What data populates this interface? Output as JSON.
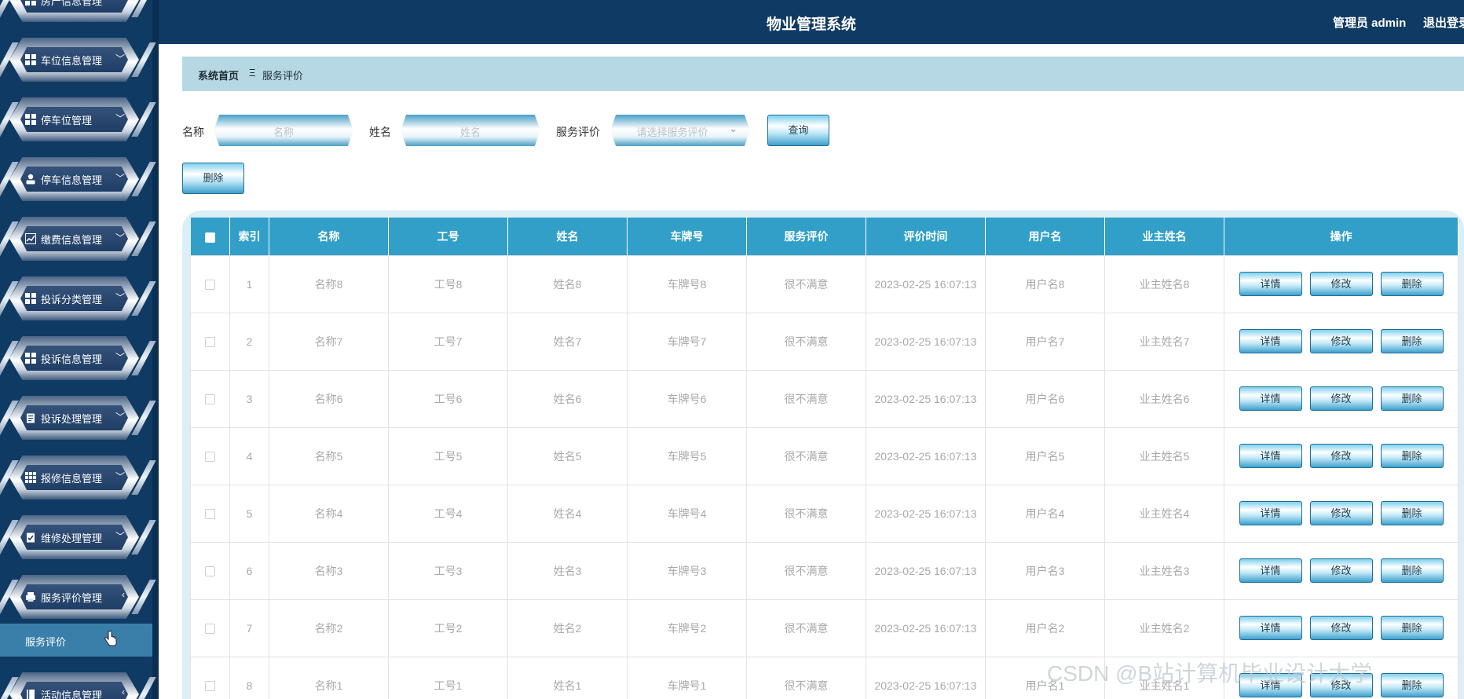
{
  "app": {
    "title": "物业管理系统",
    "admin_label": "管理员 admin",
    "logout_label": "退出登录"
  },
  "sidebar": {
    "items": [
      {
        "label": "房产信息管理",
        "icon": "grid-icon"
      },
      {
        "label": "车位信息管理",
        "icon": "grid-icon"
      },
      {
        "label": "停车位管理",
        "icon": "grid-icon"
      },
      {
        "label": "停车信息管理",
        "icon": "user-icon"
      },
      {
        "label": "缴费信息管理",
        "icon": "chart-icon"
      },
      {
        "label": "投诉分类管理",
        "icon": "grid-icon"
      },
      {
        "label": "投诉信息管理",
        "icon": "grid-icon"
      },
      {
        "label": "投诉处理管理",
        "icon": "clipboard-icon"
      },
      {
        "label": "报修信息管理",
        "icon": "grid9-icon"
      },
      {
        "label": "维修处理管理",
        "icon": "clipboard-check-icon"
      },
      {
        "label": "服务评价管理",
        "icon": "printer-icon"
      },
      {
        "label": "活动信息管理",
        "icon": "book-icon"
      }
    ],
    "active_sub": "服务评价",
    "chevron_down": "﹀",
    "chevron_left": "‹"
  },
  "breadcrumb": {
    "home": "系统首页",
    "separator": "Ξ",
    "current": "服务评价"
  },
  "search": {
    "name_label": "名称",
    "name_placeholder": "名称",
    "person_label": "姓名",
    "person_placeholder": "姓名",
    "rating_label": "服务评价",
    "rating_placeholder": "请选择服务评价",
    "query_button": "查询",
    "delete_button": "删除"
  },
  "table": {
    "headers": [
      "索引",
      "名称",
      "工号",
      "姓名",
      "车牌号",
      "服务评价",
      "评价时间",
      "用户名",
      "业主姓名",
      "操作"
    ],
    "rows": [
      {
        "idx": "1",
        "name": "名称8",
        "no": "工号8",
        "person": "姓名8",
        "plate": "车牌号8",
        "rating": "很不满意",
        "time": "2023-02-25 16:07:13",
        "user": "用户名8",
        "owner": "业主姓名8"
      },
      {
        "idx": "2",
        "name": "名称7",
        "no": "工号7",
        "person": "姓名7",
        "plate": "车牌号7",
        "rating": "很不满意",
        "time": "2023-02-25 16:07:13",
        "user": "用户名7",
        "owner": "业主姓名7"
      },
      {
        "idx": "3",
        "name": "名称6",
        "no": "工号6",
        "person": "姓名6",
        "plate": "车牌号6",
        "rating": "很不满意",
        "time": "2023-02-25 16:07:13",
        "user": "用户名6",
        "owner": "业主姓名6"
      },
      {
        "idx": "4",
        "name": "名称5",
        "no": "工号5",
        "person": "姓名5",
        "plate": "车牌号5",
        "rating": "很不满意",
        "time": "2023-02-25 16:07:13",
        "user": "用户名5",
        "owner": "业主姓名5"
      },
      {
        "idx": "5",
        "name": "名称4",
        "no": "工号4",
        "person": "姓名4",
        "plate": "车牌号4",
        "rating": "很不满意",
        "time": "2023-02-25 16:07:13",
        "user": "用户名4",
        "owner": "业主姓名4"
      },
      {
        "idx": "6",
        "name": "名称3",
        "no": "工号3",
        "person": "姓名3",
        "plate": "车牌号3",
        "rating": "很不满意",
        "time": "2023-02-25 16:07:13",
        "user": "用户名3",
        "owner": "业主姓名3"
      },
      {
        "idx": "7",
        "name": "名称2",
        "no": "工号2",
        "person": "姓名2",
        "plate": "车牌号2",
        "rating": "很不满意",
        "time": "2023-02-25 16:07:13",
        "user": "用户名2",
        "owner": "业主姓名2"
      },
      {
        "idx": "8",
        "name": "名称1",
        "no": "工号1",
        "person": "姓名1",
        "plate": "车牌号1",
        "rating": "很不满意",
        "time": "2023-02-25 16:07:13",
        "user": "用户名1",
        "owner": "业主姓名1"
      }
    ],
    "actions": {
      "detail": "详情",
      "edit": "修改",
      "delete": "删除"
    }
  },
  "watermark": "CSDN @B站计算机毕业设计大学",
  "colors": {
    "sidebar_bg": "#0f3a63",
    "header_bg": "#0f3a63",
    "table_header": "#319fc8",
    "breadcrumb_bg": "#b5d8e4"
  }
}
